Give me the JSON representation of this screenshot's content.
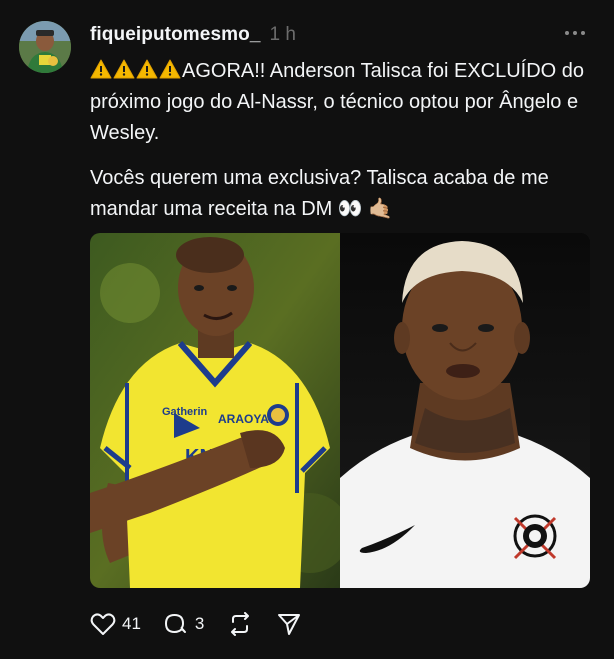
{
  "post": {
    "username": "fiqueiputomesmo_",
    "timestamp": "1 h",
    "text_line1": "AGORA!! Anderson Talisca foi EXCLUÍDO do próximo jogo do Al-Nassr, o técnico optou por Ângelo e Wesley.",
    "text_line2": "Vocês querem uma exclusiva? Talisca acaba de me mandar uma receita na DM 👀 🤙🏼",
    "warning_icon_count": 4
  },
  "media": {
    "left_kit_sponsor": "ARAOYA",
    "left_kit_brand": "Gatherin",
    "left_kit_name": "KN"
  },
  "actions": {
    "likes": "41",
    "comments": "3"
  },
  "colors": {
    "background": "#101010",
    "text": "#f3f5f7",
    "muted": "#6c6c6c",
    "yellow_kit": "#f2e530",
    "blue_trim": "#1d3c8c"
  }
}
